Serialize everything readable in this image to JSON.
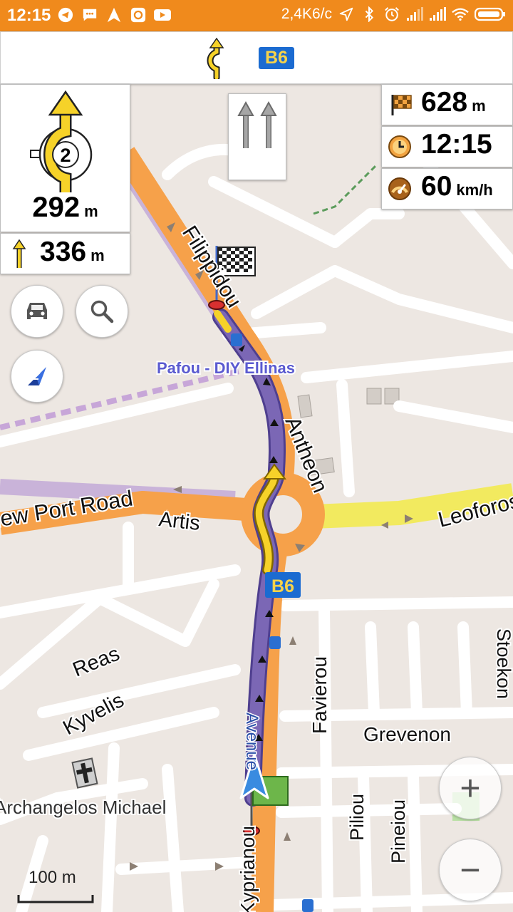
{
  "status_bar": {
    "time": "12:15",
    "speed": "2,4K6/c",
    "left_icons": [
      "telegram-icon",
      "message-icon",
      "navigation-icon",
      "instagram-icon",
      "youtube-icon"
    ],
    "right_icons": [
      "location-icon",
      "bluetooth-icon",
      "alarm-icon",
      "signal-icon",
      "signal-icon",
      "wifi-icon",
      "battery-icon"
    ]
  },
  "top_bar": {
    "street_badge": "B6",
    "icon": "roundabout-exit-icon"
  },
  "turn_panel": {
    "exit_number": "2",
    "distance_value": "292",
    "distance_unit": "m",
    "icon": "roundabout-turn-icon"
  },
  "next_turn": {
    "distance_value": "336",
    "distance_unit": "m",
    "icon": "straight-arrow-icon"
  },
  "lanes": {
    "count": 2,
    "icon": "lane-straight-icon"
  },
  "info_widgets": {
    "distance_to_destination": {
      "value": "628",
      "unit": "m",
      "icon": "checkered-flag-icon"
    },
    "arrival_time": {
      "value": "12:15",
      "icon": "clock-icon"
    },
    "speed": {
      "value": "60",
      "unit": "km/h",
      "icon": "speedometer-icon"
    }
  },
  "map_buttons": {
    "profile": "car-icon",
    "search": "search-icon",
    "compass": "compass-icon",
    "zoom_in": "+",
    "zoom_out": "−"
  },
  "map_labels": {
    "poi": "Pafou - DIY Ellinas",
    "filippidou": "Filippidou",
    "antheon": "Antheon",
    "new_port_road": "New Port Road",
    "artis": "Artis",
    "leoforos": "Leoforos",
    "road_badge": "B6",
    "reas": "Reas",
    "kyvelis": "Kyvelis",
    "favierou": "Favierou",
    "grevenon": "Grevenon",
    "stoekon": "Stoekon",
    "piliou": "Piliou",
    "pineiou": "Pineiou",
    "church": "Archangelos Michael",
    "kyprianou": "Kyprianou",
    "avenue": "Avenue"
  },
  "scale": {
    "label": "100 m"
  },
  "colors": {
    "status_bar": "#f08a1c",
    "primary_road": "#f6a14a",
    "secondary_road": "#f2ea5f",
    "route": "#7b67b5",
    "badge_bg": "#1b6bd1",
    "badge_text": "#f7d34a",
    "turn_yellow": "#f6d229",
    "poi_text": "#5a5ad0"
  }
}
